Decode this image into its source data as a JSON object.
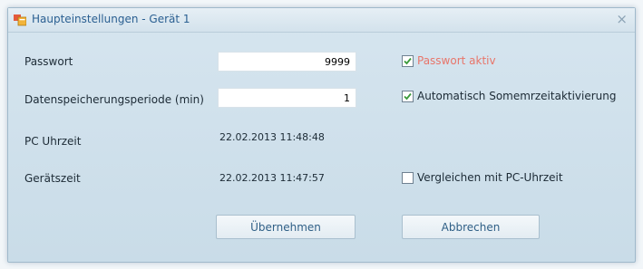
{
  "window": {
    "title": "Haupteinstellungen  -  Gerät 1",
    "close_glyph": "×"
  },
  "form": {
    "password_label": "Passwort",
    "password_value": "9999",
    "password_active_label": "Passwort aktiv",
    "password_active_checked": true,
    "period_label": "Datenspeicherungsperiode (min)",
    "period_value": "1",
    "dst_label": "Automatisch Somemrzeitaktivierung",
    "dst_checked": true,
    "pc_time_label": "PC Uhrzeit",
    "pc_time_value": "22.02.2013 11:48:48",
    "device_time_label": "Gerätszeit",
    "device_time_value": "22.02.2013 11:47:57",
    "compare_label": "Vergleichen mit PC-Uhrzeit",
    "compare_checked": false
  },
  "buttons": {
    "apply": "Übernehmen",
    "cancel": "Abbrechen"
  },
  "colors": {
    "accent_red": "#e8756a",
    "title_blue": "#2a5f91",
    "check_green": "#3a9a3a"
  },
  "icons": {
    "app": "window-settings-icon",
    "close": "close-icon",
    "check": "checkmark-icon"
  }
}
